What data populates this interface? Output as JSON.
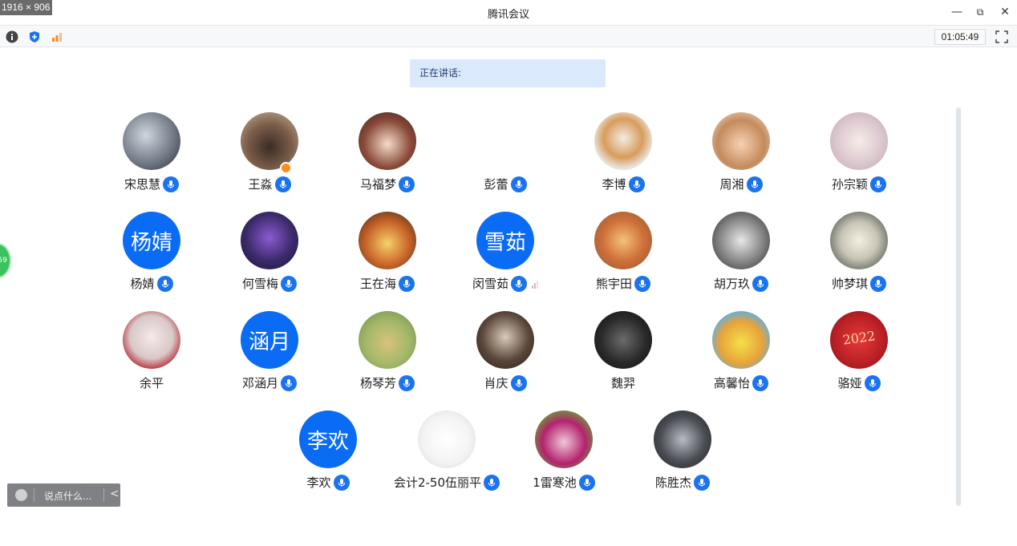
{
  "overlay": {
    "dimensions": "1916 × 906"
  },
  "window": {
    "title": "腾讯会议"
  },
  "window_controls": {
    "minimize": "—",
    "restore": "⧉",
    "close": "✕"
  },
  "toolbar": {
    "timer": "01:05:49",
    "icons": [
      "info-icon",
      "shield-icon",
      "signal-icon"
    ],
    "fullscreen_icon": "fullscreen-icon"
  },
  "speaking": {
    "label": "正在讲话:"
  },
  "side_badge": {
    "text": "59"
  },
  "participants": [
    {
      "name": "宋思慧",
      "avatar_text": "",
      "photo": "couple-photo",
      "mic": true
    },
    {
      "name": "王淼",
      "avatar_text": "",
      "photo": "sleeping-photo",
      "mic": true,
      "host": true
    },
    {
      "name": "马福梦",
      "avatar_text": "",
      "photo": "anime-girl",
      "mic": true
    },
    {
      "name": "彭蕾",
      "avatar_text": "",
      "photo": "blank",
      "mic": true
    },
    {
      "name": "李博",
      "avatar_text": "",
      "photo": "shiba-dog",
      "mic": true
    },
    {
      "name": "周湘",
      "avatar_text": "",
      "photo": "laughing-baby",
      "mic": true
    },
    {
      "name": "孙宗颖",
      "avatar_text": "",
      "photo": "cartoon-girl",
      "mic": true
    },
    {
      "name": "杨婧",
      "avatar_text": "杨婧",
      "photo": "text",
      "mic": true
    },
    {
      "name": "何雪梅",
      "avatar_text": "",
      "photo": "purple-art",
      "mic": true
    },
    {
      "name": "王在海",
      "avatar_text": "",
      "photo": "cartoon-alice",
      "mic": true
    },
    {
      "name": "闵雪茹",
      "avatar_text": "雪茹",
      "photo": "text",
      "mic": true,
      "signal": true
    },
    {
      "name": "熊宇田",
      "avatar_text": "",
      "photo": "autumn-painting",
      "mic": true
    },
    {
      "name": "胡万玖",
      "avatar_text": "",
      "photo": "mirror-selfie",
      "mic": true
    },
    {
      "name": "帅梦琪",
      "avatar_text": "",
      "photo": "girl-pose",
      "mic": true
    },
    {
      "name": "余平",
      "avatar_text": "",
      "photo": "doll-girl",
      "mic": false
    },
    {
      "name": "邓涵月",
      "avatar_text": "涵月",
      "photo": "text",
      "mic": true
    },
    {
      "name": "杨琴芳",
      "avatar_text": "",
      "photo": "garden-bear",
      "mic": true
    },
    {
      "name": "肖庆",
      "avatar_text": "",
      "photo": "girl-back",
      "mic": true
    },
    {
      "name": "魏羿",
      "avatar_text": "",
      "photo": "dark-portrait",
      "mic": false
    },
    {
      "name": "高馨怡",
      "avatar_text": "",
      "photo": "spongebob",
      "mic": true
    },
    {
      "name": "骆娅",
      "avatar_text": "",
      "photo": "red-2022",
      "mic": true,
      "photo_text": "2022"
    },
    {
      "name": "李欢",
      "avatar_text": "李欢",
      "photo": "text",
      "mic": true
    },
    {
      "name": "会计2-50伍丽平",
      "avatar_text": "",
      "photo": "hello-kitty",
      "mic": true
    },
    {
      "name": "1雷寒池",
      "avatar_text": "",
      "photo": "magenta-heart",
      "mic": true
    },
    {
      "name": "陈胜杰",
      "avatar_text": "",
      "photo": "street-photo",
      "mic": true
    }
  ],
  "chat": {
    "placeholder": "说点什么...",
    "collapse_icon": "<"
  },
  "colors": {
    "accent": "#0a6cf5",
    "mic": "#1a73f0",
    "speaking_bg": "#dbe9fc"
  }
}
